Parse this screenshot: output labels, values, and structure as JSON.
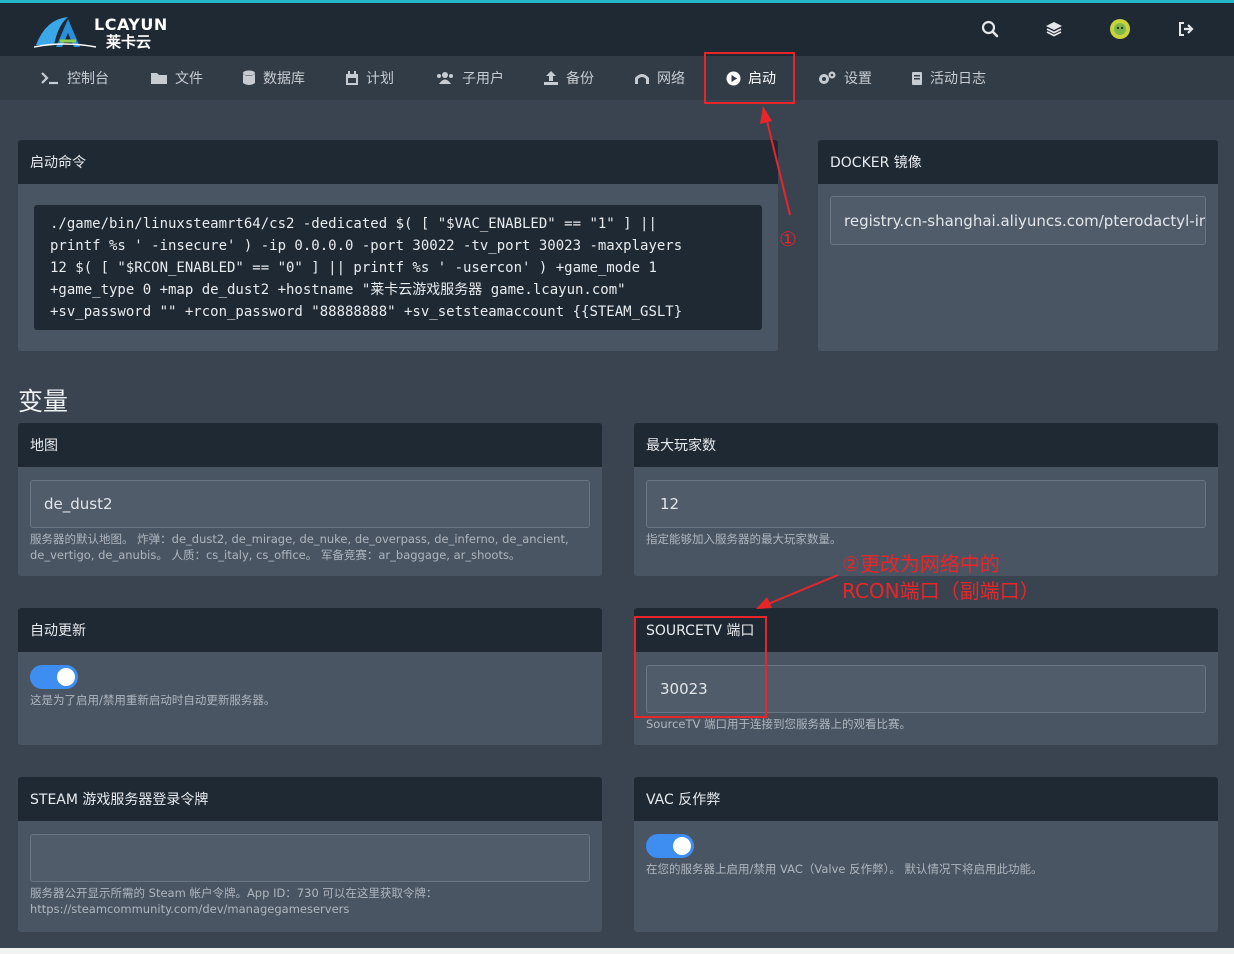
{
  "brand": {
    "name_en": "LCAYUN",
    "name_cn": "莱卡云",
    "accent": "#25b6c8"
  },
  "topbar_icons": [
    "search-icon",
    "layers-icon",
    "avatar",
    "logout-icon"
  ],
  "nav": {
    "items": [
      {
        "label": "控制台",
        "icon": "terminal-icon"
      },
      {
        "label": "文件",
        "icon": "folder-icon"
      },
      {
        "label": "数据库",
        "icon": "database-icon"
      },
      {
        "label": "计划",
        "icon": "calendar-icon"
      },
      {
        "label": "子用户",
        "icon": "users-icon"
      },
      {
        "label": "备份",
        "icon": "upload-icon"
      },
      {
        "label": "网络",
        "icon": "network-icon"
      },
      {
        "label": "启动",
        "icon": "play-circle-icon",
        "active": true
      },
      {
        "label": "设置",
        "icon": "gears-icon"
      },
      {
        "label": "活动日志",
        "icon": "book-icon"
      }
    ]
  },
  "startup": {
    "title": "启动命令",
    "command_lines": [
      "./game/bin/linuxsteamrt64/cs2 -dedicated $( [ \"$VAC_ENABLED\" == \"1\" ] ||",
      "printf %s ' -insecure' ) -ip 0.0.0.0 -port 30022 -tv_port 30023 -maxplayers",
      "12 $( [ \"$RCON_ENABLED\" == \"0\" ] || printf %s ' -usercon' ) +game_mode 1",
      "+game_type 0 +map de_dust2 +hostname \"莱卡云游戏服务器 game.lcayun.com\"",
      "+sv_password \"\" +rcon_password \"88888888\" +sv_setsteamaccount {{STEAM_GSLT}"
    ]
  },
  "docker": {
    "title": "DOCKER 镜像",
    "value": "registry.cn-shanghai.aliyuncs.com/pterodactyl-images"
  },
  "variables": {
    "title": "变量",
    "map": {
      "title": "地图",
      "value": "de_dust2",
      "help_1": "服务器的默认地图。 炸弹：de_dust2, de_mirage, de_nuke, de_overpass, de_inferno, de_ancient,",
      "help_2": "de_vertigo, de_anubis。 人质：cs_italy, cs_office。 军备竞赛：ar_baggage, ar_shoots。"
    },
    "max_players": {
      "title": "最大玩家数",
      "value": "12",
      "help": "指定能够加入服务器的最大玩家数量。"
    },
    "auto_update": {
      "title": "自动更新",
      "enabled": true,
      "help": "这是为了启用/禁用重新启动时自动更新服务器。"
    },
    "sourcetv_port": {
      "title": "SOURCETV 端口",
      "value": "30023",
      "help": "SourceTV 端口用于连接到您服务器上的观看比赛。"
    },
    "steam_token": {
      "title": "STEAM 游戏服务器登录令牌",
      "value": "",
      "help_1": "服务器公开显示所需的 Steam 帐户令牌。App ID：730 可以在这里获取令牌：",
      "help_2": "https://steamcommunity.com/dev/managegameservers"
    },
    "vac": {
      "title": "VAC 反作弊",
      "enabled": true,
      "help": "在您的服务器上启用/禁用 VAC（Valve 反作弊）。 默认情况下将启用此功能。"
    }
  },
  "annotations": {
    "step1": "①",
    "step2_line1": "②更改为网络中的",
    "step2_line2": "RCON端口（副端口）",
    "color": "#e8262a"
  }
}
